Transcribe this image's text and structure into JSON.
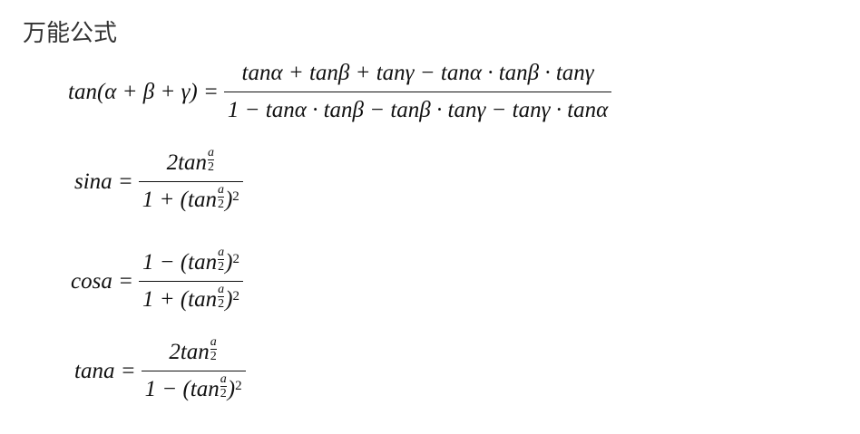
{
  "title": "万能公式",
  "formulas": [
    {
      "lhs": "tan(α + β + γ) =",
      "num": {
        "pre": "tanα + tanβ + tanγ − tanα · tanβ · tanγ",
        "fn": "",
        "fd": "",
        "post": "",
        "sup": ""
      },
      "den": {
        "pre": "1 − tanα · tanβ − tanβ · tanγ − tanγ · tanα",
        "fn": "",
        "fd": "",
        "post": "",
        "sup": ""
      }
    },
    {
      "lhs": "sina =",
      "num": {
        "pre": "2tan",
        "fn": "a",
        "fd": "2",
        "post": "",
        "sup": ""
      },
      "den": {
        "pre": "1 + (tan",
        "fn": "a",
        "fd": "2",
        "post": ")",
        "sup": "2"
      }
    },
    {
      "lhs": "cosa =",
      "num": {
        "pre": "1 − (tan",
        "fn": "a",
        "fd": "2",
        "post": ")",
        "sup": "2"
      },
      "den": {
        "pre": "1 + (tan",
        "fn": "a",
        "fd": "2",
        "post": ")",
        "sup": "2"
      }
    },
    {
      "lhs": "tana =",
      "num": {
        "pre": "2tan",
        "fn": "a",
        "fd": "2",
        "post": "",
        "sup": ""
      },
      "den": {
        "pre": "1 − (tan",
        "fn": "a",
        "fd": "2",
        "post": ")",
        "sup": "2"
      }
    }
  ]
}
